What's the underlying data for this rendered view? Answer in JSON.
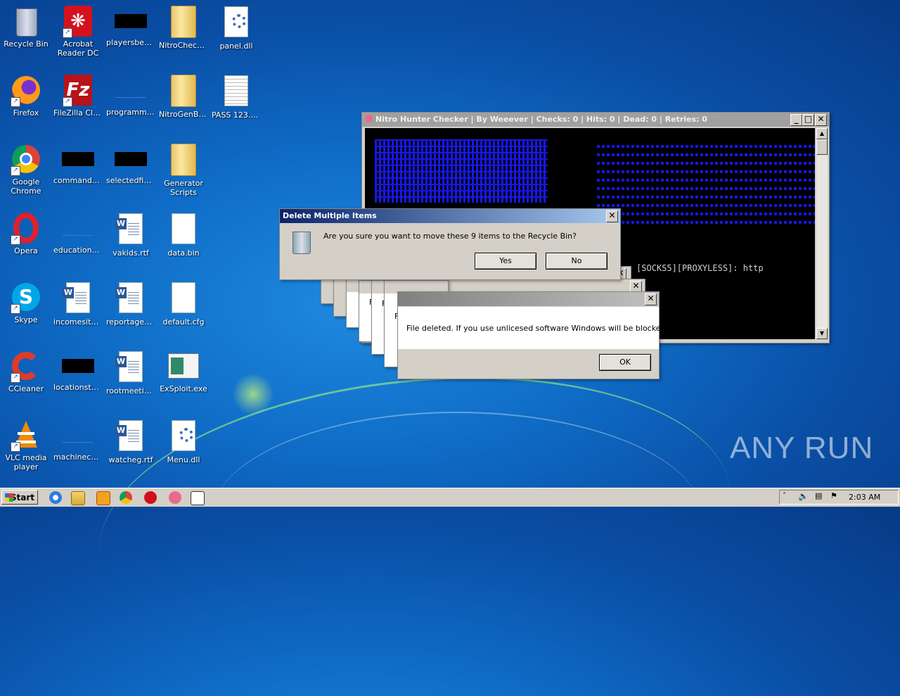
{
  "desktop": {
    "icons": [
      {
        "label": "Recycle Bin"
      },
      {
        "label": "Acrobat Reader DC"
      },
      {
        "label": "playersbea..."
      },
      {
        "label": "NitroChecker"
      },
      {
        "label": "panel.dll"
      },
      {
        "label": "Firefox"
      },
      {
        "label": "FileZilla Client"
      },
      {
        "label": "programmin..."
      },
      {
        "label": "NitroGenBy..."
      },
      {
        "label": "PASS 123.txt"
      },
      {
        "label": "Google Chrome"
      },
      {
        "label": "commandon..."
      },
      {
        "label": "selectedfiel..."
      },
      {
        "label": "Generator Scripts"
      },
      {
        "label": "Opera"
      },
      {
        "label": "educationce..."
      },
      {
        "label": "vakids.rtf"
      },
      {
        "label": "data.bin"
      },
      {
        "label": "Skype"
      },
      {
        "label": "incomesitua..."
      },
      {
        "label": "reportagent..."
      },
      {
        "label": "default.cfg"
      },
      {
        "label": "CCleaner"
      },
      {
        "label": "locationstur..."
      },
      {
        "label": "rootmeeting..."
      },
      {
        "label": "ExSploit.exe"
      },
      {
        "label": "VLC media player"
      },
      {
        "label": "machinecan..."
      },
      {
        "label": "watcheg.rtf"
      },
      {
        "label": "Menu.dll"
      }
    ]
  },
  "console": {
    "title": "Nitro Hunter Checker | By Weeever | Checks: 0 | Hits: 0 | Dead: 0 | Retries: 0",
    "prompt": "[SOCKS5][PROXYLESS]: http",
    "banner_color": "#1a1aff"
  },
  "delete_dialog": {
    "title": "Delete Multiple Items",
    "message": "Are you sure you want to move these 9 items to the Recycle Bin?",
    "yes_label": "Yes",
    "no_label": "No"
  },
  "stack_letters": [
    "F",
    "F",
    "F",
    "F"
  ],
  "message_dialog": {
    "message": "File deleted. If you use unlicesed software Windows will be blocked.",
    "ok_label": "OK"
  },
  "taskbar": {
    "start_label": "Start",
    "clock": "2:03 AM"
  },
  "watermark": "ANY RUN"
}
